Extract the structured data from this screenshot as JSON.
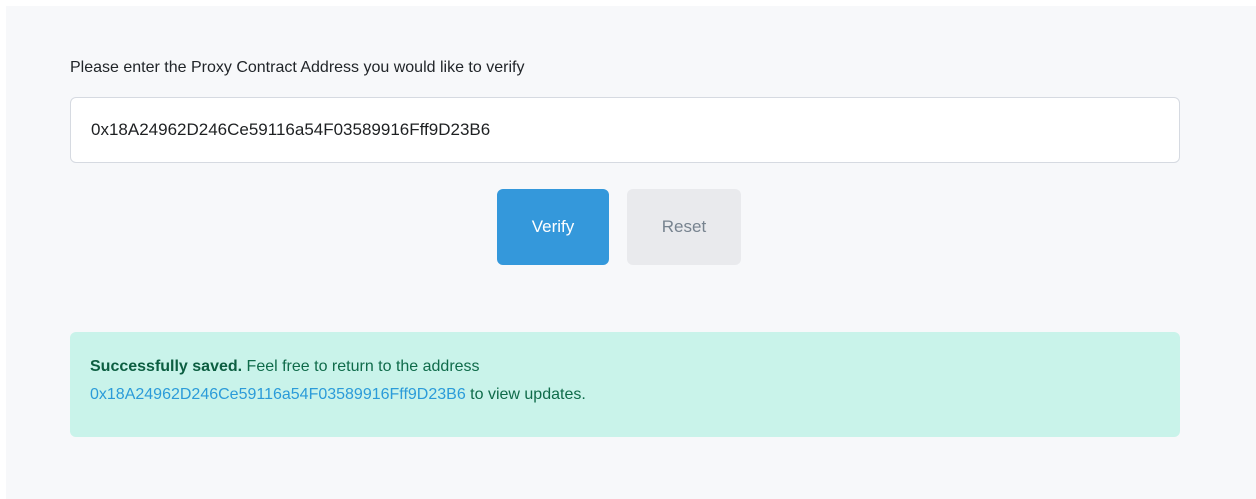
{
  "form": {
    "prompt_label": "Please enter the Proxy Contract Address you would like to verify",
    "address_value": "0x18A24962D246Ce59116a54F03589916Fff9D23B6",
    "verify_label": "Verify",
    "reset_label": "Reset"
  },
  "alert": {
    "title": "Successfully saved.",
    "text_before_link": " Feel free to return to the address",
    "link_text": "0x18A24962D246Ce59116a54F03589916Fff9D23B6",
    "text_after_link": " to view updates."
  },
  "colors": {
    "panel_bg": "#f7f8fa",
    "primary": "#3498db",
    "secondary_bg": "#e9eaed",
    "success_bg": "#c9f3ea",
    "success_text": "#0f6b4a",
    "link": "#2b9bd9"
  }
}
